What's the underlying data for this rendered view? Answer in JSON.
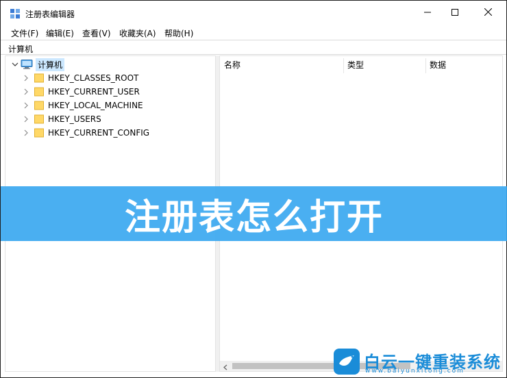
{
  "window": {
    "title": "注册表编辑器",
    "app_icon": "registry-editor-icon",
    "controls": {
      "minimize": "minimize-icon",
      "maximize": "maximize-icon",
      "close": "close-icon"
    }
  },
  "menu": {
    "items": [
      {
        "label": "文件(F)"
      },
      {
        "label": "编辑(E)"
      },
      {
        "label": "查看(V)"
      },
      {
        "label": "收藏夹(A)"
      },
      {
        "label": "帮助(H)"
      }
    ]
  },
  "address": {
    "path": "计算机"
  },
  "tree": {
    "root": {
      "label": "计算机",
      "icon": "computer-icon",
      "expanded": true,
      "selected": true
    },
    "keys": [
      {
        "label": "HKEY_CLASSES_ROOT",
        "icon": "folder-icon"
      },
      {
        "label": "HKEY_CURRENT_USER",
        "icon": "folder-icon"
      },
      {
        "label": "HKEY_LOCAL_MACHINE",
        "icon": "folder-icon"
      },
      {
        "label": "HKEY_USERS",
        "icon": "folder-icon"
      },
      {
        "label": "HKEY_CURRENT_CONFIG",
        "icon": "folder-icon"
      }
    ]
  },
  "list": {
    "columns": [
      {
        "label": "名称"
      },
      {
        "label": "类型"
      },
      {
        "label": "数据"
      }
    ]
  },
  "banner": {
    "text": "注册表怎么打开",
    "color": "#3ba8f0"
  },
  "watermark": {
    "name": "白云一键重装系统",
    "url": "www.baiyunxitong.com",
    "color": "#1a8cd8"
  }
}
